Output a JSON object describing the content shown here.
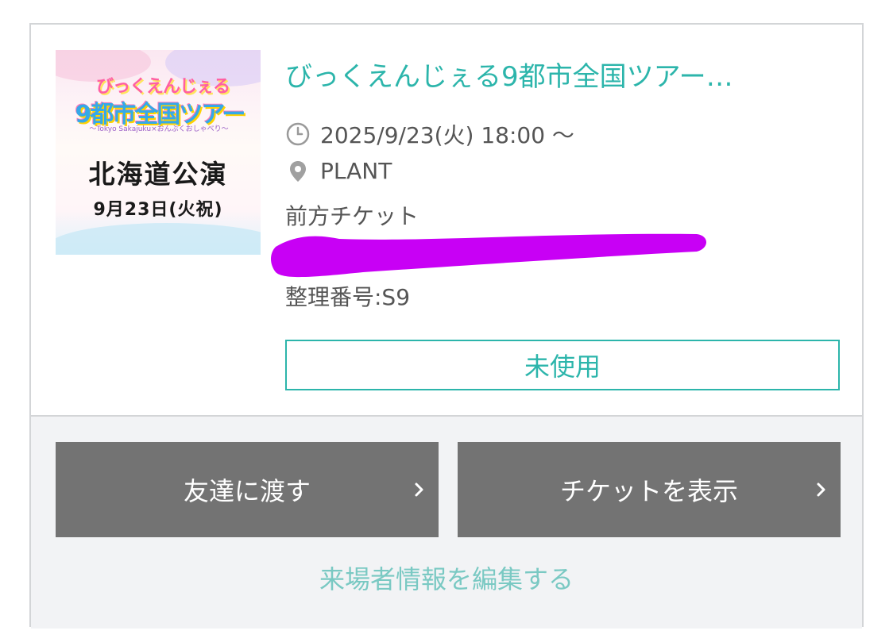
{
  "event": {
    "title": "びっくえんじぇる9都市全国ツアー…",
    "datetime": "2025/9/23(火) 18:00 〜",
    "venue": "PLANT",
    "ticket_type": "前方チケット",
    "seat_number": "整理番号:S9",
    "status": "未使用",
    "image": {
      "logo_line1": "びっくえんじぇる",
      "logo_line2": "9都市全国ツアー",
      "logo_line3": "〜Tokyo Sakajuku×おんぷくおしゃべり〜",
      "performance": "北海道公演",
      "date": "9月23日(火祝)"
    }
  },
  "actions": {
    "give_friend": "友達に渡す",
    "show_ticket": "チケットを表示",
    "edit_info": "来場者情報を編集する"
  },
  "icons": {
    "time": "clock-icon",
    "place": "location-pin-icon",
    "chevron": "chevron-right-icon"
  },
  "colors": {
    "accent": "#2cb5ab",
    "button_bg": "#737373",
    "redaction": "#c800f5",
    "footer_bg": "#f2f3f5"
  }
}
